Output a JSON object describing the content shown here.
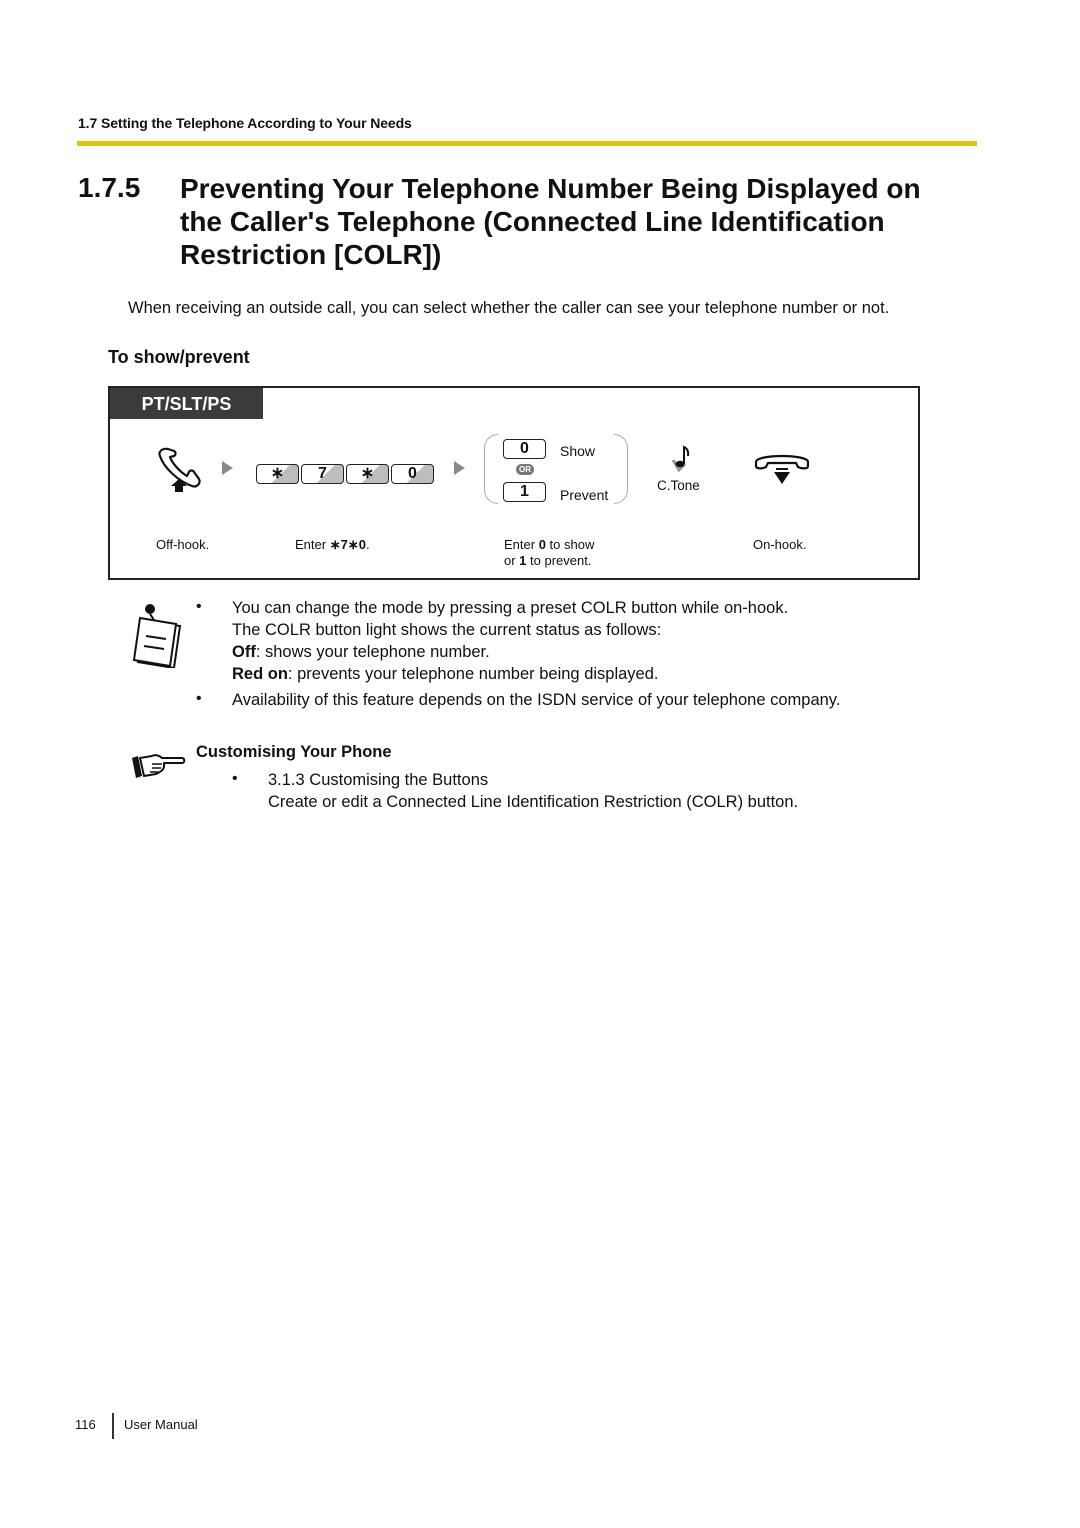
{
  "header": {
    "running_head": "1.7 Setting the Telephone According to Your Needs",
    "accent_color": "#e0c400"
  },
  "section": {
    "number": "1.7.5",
    "title": "Preventing Your Telephone Number Being Displayed on the Caller's Telephone (Connected Line Identification Restriction [COLR])",
    "intro": "When receiving an outside call, you can select whether the caller can see your telephone number or not."
  },
  "procedure": {
    "subheading": "To show/prevent",
    "tab_label": "PT/SLT/PS",
    "steps": [
      {
        "icon": "off-hook-icon",
        "caption": "Off-hook."
      },
      {
        "icon": "keypad-keys",
        "keys": [
          "∗",
          "7",
          "∗",
          "0"
        ],
        "caption_prefix": "Enter ",
        "caption_bold": "∗7∗0",
        "caption_suffix": "."
      },
      {
        "options": [
          {
            "key": "0",
            "label": "Show"
          },
          {
            "key": "1",
            "label": "Prevent"
          }
        ],
        "or_label": "OR",
        "caption_line1_prefix": "Enter ",
        "caption_line1_bold": "0",
        "caption_line1_suffix": " to show",
        "caption_line2_prefix": "or ",
        "caption_line2_bold": "1",
        "caption_line2_suffix": " to prevent."
      },
      {
        "icon": "confirmation-tone-icon",
        "label": "C.Tone"
      },
      {
        "icon": "on-hook-icon",
        "caption": "On-hook."
      }
    ]
  },
  "notes": {
    "bullets": [
      {
        "lines": [
          {
            "text": "You can change the mode by pressing a preset COLR button while on-hook."
          },
          {
            "text": "The COLR button light shows the current status as follows:"
          },
          {
            "bold": "Off",
            "text": ": shows your telephone number."
          },
          {
            "bold": "Red on",
            "text": ": prevents your telephone number being displayed."
          }
        ]
      },
      {
        "lines": [
          {
            "text": "Availability of this feature depends on the ISDN service of your telephone company."
          }
        ]
      }
    ],
    "bullet_char": "•"
  },
  "reference": {
    "heading": "Customising Your Phone",
    "items": [
      {
        "title": "3.1.3 Customising the Buttons",
        "description": "Create or edit a Connected Line Identification Restriction (COLR) button."
      }
    ]
  },
  "footer": {
    "page_number": "116",
    "label": "User Manual"
  }
}
